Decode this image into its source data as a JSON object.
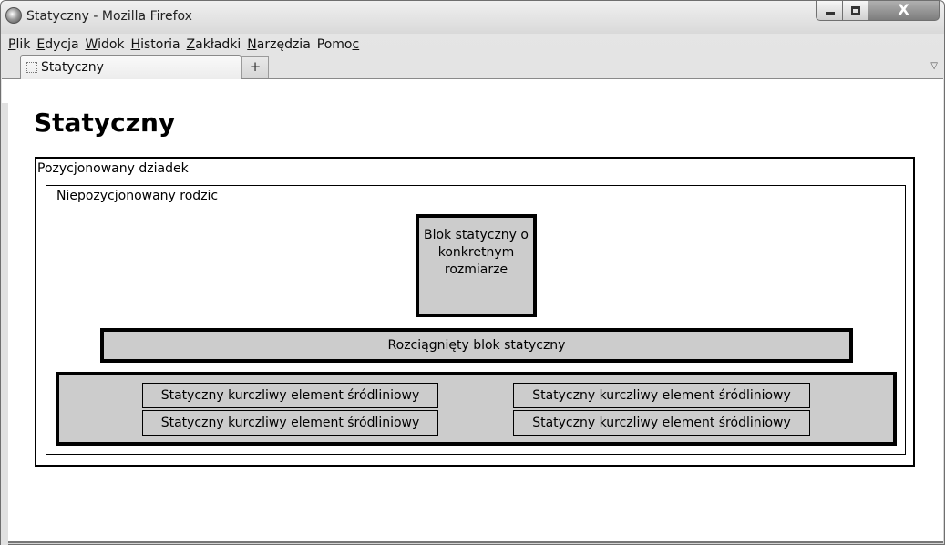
{
  "window": {
    "title": "Statyczny - Mozilla Firefox",
    "controls": {
      "minimize": "",
      "maximize": "",
      "close": "X"
    }
  },
  "menu": {
    "items": [
      {
        "first": "P",
        "rest": "lik"
      },
      {
        "first": "E",
        "rest": "dycja"
      },
      {
        "first": "W",
        "rest": "idok"
      },
      {
        "first": "H",
        "rest": "istoria"
      },
      {
        "first": "Z",
        "rest": "akładki"
      },
      {
        "first": "N",
        "rest": "arzędzia"
      },
      {
        "first": "Pomo",
        "rest": "c"
      }
    ]
  },
  "tabs": {
    "active": "Statyczny",
    "new_tab": "+",
    "list_arrow": "▽"
  },
  "page": {
    "heading": "Statyczny",
    "grandparent_label": "Pozycjonowany dziadek",
    "parent_label": "Niepozycjonowany rodzic",
    "static_block": "Blok statyczny o konkretnym rozmiarze",
    "stretched_block": "Rozciągnięty blok statyczny",
    "inline_elements": [
      "Statyczny kurczliwy element śródliniowy",
      "Statyczny kurczliwy element śródliniowy",
      "Statyczny kurczliwy element śródliniowy",
      "Statyczny kurczliwy element śródliniowy"
    ]
  }
}
